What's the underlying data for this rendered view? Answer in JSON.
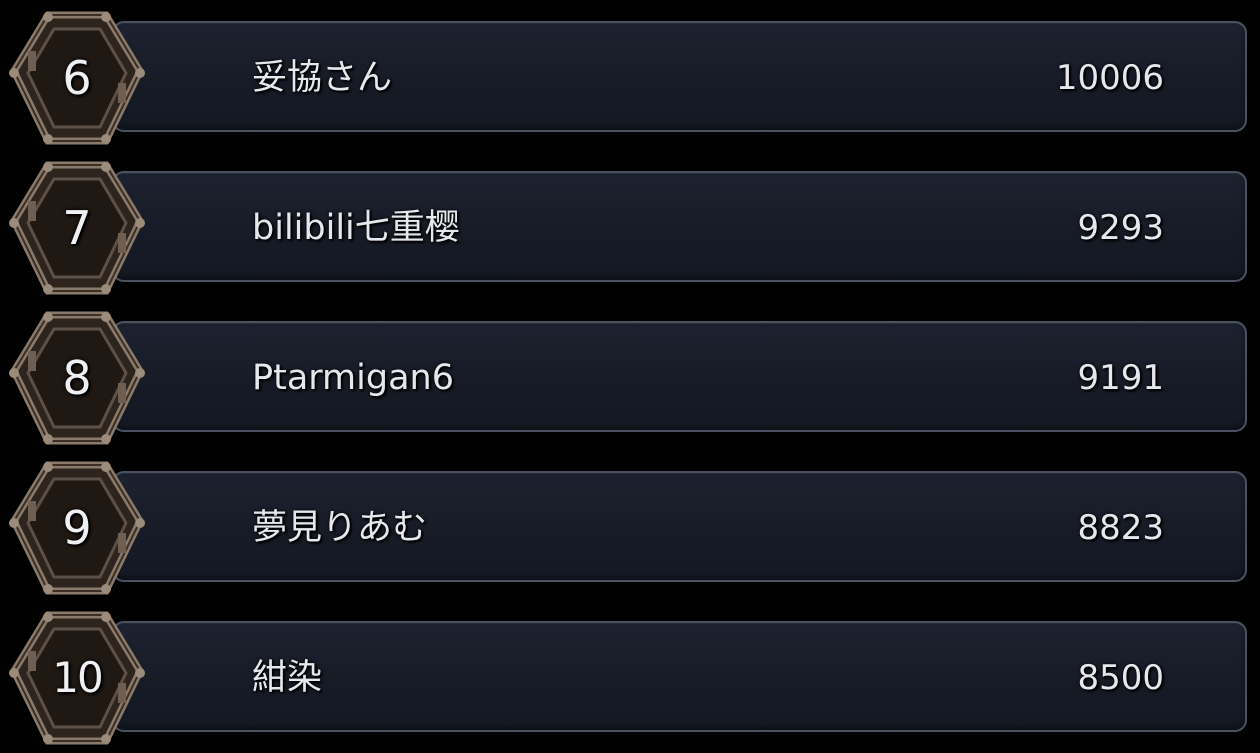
{
  "leaderboard": {
    "entries": [
      {
        "rank": "6",
        "name": "妥協さん",
        "score": "10006"
      },
      {
        "rank": "7",
        "name": "bilibili七重樱",
        "score": "9293"
      },
      {
        "rank": "8",
        "name": "Ptarmigan6",
        "score": "9191"
      },
      {
        "rank": "9",
        "name": "夢見りあむ",
        "score": "8823"
      },
      {
        "rank": "10",
        "name": "紺染",
        "score": "8500"
      }
    ],
    "badge_icon": "ornate-metal-frame-icon",
    "colors": {
      "background": "#000000",
      "panel": "#1b1f2b",
      "panel_border": "#4a5262",
      "text": "#e6e8ee",
      "badge_frame": "#7a6a5c",
      "badge_fill": "#2a1f18"
    }
  }
}
